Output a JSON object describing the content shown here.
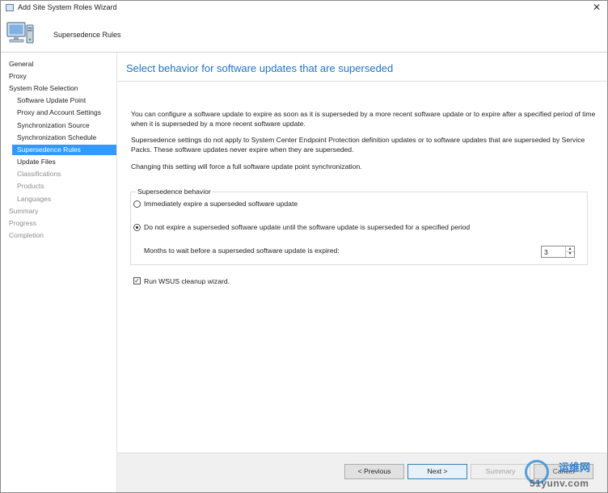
{
  "window": {
    "title": "Add Site System Roles Wizard",
    "close_glyph": "✕"
  },
  "banner": {
    "title": "Supersedence Rules",
    "icon": "computer-icon"
  },
  "sidebar": {
    "items": [
      {
        "label": "General",
        "state": "visited"
      },
      {
        "label": "Proxy",
        "state": "visited"
      },
      {
        "label": "System Role Selection",
        "state": "visited"
      },
      {
        "label": "Software Update Point",
        "state": "visited"
      },
      {
        "label": "Proxy and Account Settings",
        "state": "visited"
      },
      {
        "label": "Synchronization Source",
        "state": "visited"
      },
      {
        "label": "Synchronization Schedule",
        "state": "visited"
      },
      {
        "label": "Supersedence Rules",
        "state": "active"
      },
      {
        "label": "Update Files",
        "state": "visited"
      },
      {
        "label": "Classifications",
        "state": "pending"
      },
      {
        "label": "Products",
        "state": "pending"
      },
      {
        "label": "Languages",
        "state": "pending"
      },
      {
        "label": "Summary",
        "state": "pending"
      },
      {
        "label": "Progress",
        "state": "pending"
      },
      {
        "label": "Completion",
        "state": "pending"
      }
    ]
  },
  "main": {
    "heading": "Select behavior for software updates that are superseded",
    "para1": "You can configure a software update to expire as soon as it is superseded by a more recent software update or to expire after a specified period of time when it is superseded by a more recent software update.",
    "para2": "Supersedence settings do not apply to System Center Endpoint Protection definition updates or to software updates that are superseded by Service Packs. These software updates never expire when they are superseded.",
    "para3": "Changing this setting will force a full software update point synchronization.",
    "group": {
      "title": "Supersedence behavior",
      "option1": "Immediately expire a superseded software update",
      "option2": "Do not expire a superseded software update until the software update is superseded for a specified period",
      "selected": "option2",
      "months_label": "Months to wait before a superseded software update is expired:",
      "months_value": "3"
    },
    "wsus_cleanup": {
      "label": "Run WSUS cleanup wizard.",
      "checked": true,
      "check_glyph": "✓"
    }
  },
  "footer": {
    "previous": "< Previous",
    "next": "Next >",
    "summary": "Summary",
    "cancel": "Cancel"
  },
  "watermark": {
    "cn": "运维网",
    "url": "51yunv.com"
  },
  "colors": {
    "accent": "#1e73c8",
    "selection": "#3399ff"
  }
}
